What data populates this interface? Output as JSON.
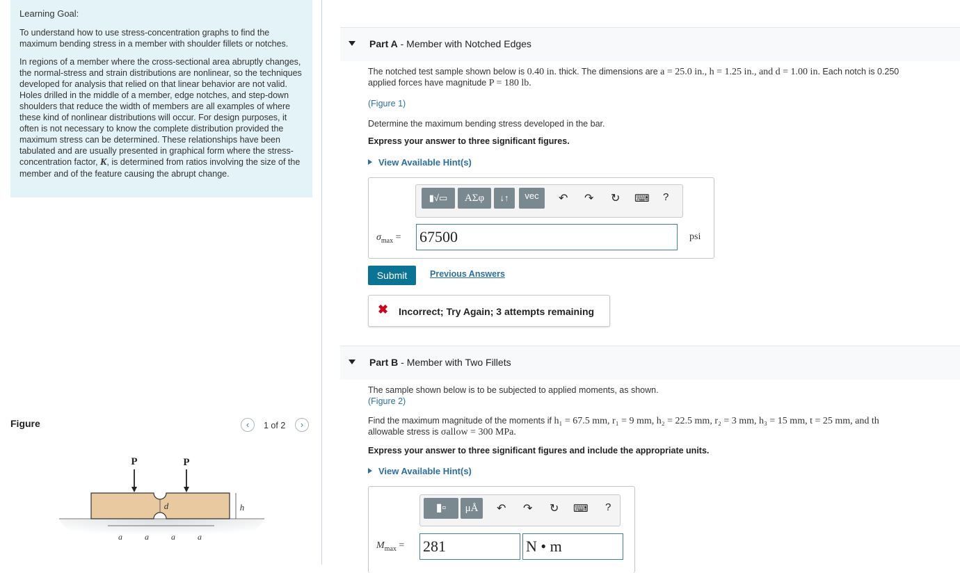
{
  "learning_goal": {
    "title": "Learning Goal:",
    "paragraph1": "To understand how to use stress-concentration graphs to find the maximum bending stress in a member with shoulder fillets or notches.",
    "paragraph2_before": "In regions of a member where the cross-sectional area abruptly changes, the normal-stress and strain distributions are nonlinear, so the techniques developed for analysis that relied on that linear behavior are not valid. Holes drilled in the middle of a member, edge notches, and step-down shoulders that reduce the width of members are all examples of where these kind of nonlinear distributions will occur. For design purposes, it often is not necessary to know the complete distribution provided the maximum stress can be determined. These relationships have been tabulated and are usually presented in graphical form where the stress-concentration factor, ",
    "paragraph2_symbol": "K",
    "paragraph2_after": ", is determined from ratios involving the size of the member and of the feature causing the abrupt change."
  },
  "figure": {
    "title": "Figure",
    "pager": "1 of 2",
    "prev_icon": "chevron-left-icon",
    "next_icon": "chevron-right-icon",
    "labels": {
      "force1": "P",
      "force2": "P",
      "notch": "d",
      "height": "h",
      "dims": [
        "a",
        "a",
        "a",
        "a"
      ]
    }
  },
  "part_a": {
    "label": "Part A",
    "title": "Member with Notched Edges",
    "statement_start": "The notched test sample shown below is ",
    "thickness": "0.40 in.",
    "statement_mid": " thick. The dimensions are ",
    "dims": "a = 25.0 in., h = 1.25 in., and d = 1.00 in.",
    "statement_end": " Each notch is 0.250",
    "statement_line2_start": "applied forces have magnitude ",
    "force": "P = 180 lb.",
    "figure_link": "(Figure 1)",
    "question": "Determine the maximum bending stress developed in the bar.",
    "instruction": "Express your answer to three significant figures.",
    "hint": "View Available Hint(s)",
    "toolbar": {
      "templates": "▮√▭",
      "greek": "ΑΣφ",
      "arrows": "↓↑",
      "vec": "vec",
      "help": "?"
    },
    "answer_label_var": "σ",
    "answer_label_sub": "max",
    "answer_value": "67500",
    "unit": "psi",
    "submit": "Submit",
    "previous_answers": "Previous Answers",
    "feedback": "Incorrect; Try Again; 3 attempts remaining",
    "feedback_color": "#d0021b"
  },
  "part_b": {
    "label": "Part B",
    "title": "Member with Two Fillets",
    "statement": "The sample shown below is to be subjected to applied moments, as shown.",
    "figure_link": "(Figure 2)",
    "find_start": "Find the maximum magnitude of the moments if ",
    "find_values": "h₁ = 67.5 mm, r₁ = 9 mm, h₂ = 22.5 mm, r₂ = 3 mm, h₃ = 15 mm, t = 25 mm, and th",
    "find_line2_start": "allowable stress is ",
    "allow": "σallow = 300 MPa.",
    "instruction": "Express your answer to three significant figures and include the appropriate units.",
    "hint": "View Available Hint(s)",
    "toolbar": {
      "units": "μÅ",
      "help": "?"
    },
    "answer_label_var": "M",
    "answer_label_sub": "max",
    "answer_value": "281",
    "answer_unit": "N • m"
  },
  "colors": {
    "accent": "#0b7393",
    "link": "#2c6fa3",
    "goal_bg": "#e4f3f7"
  }
}
